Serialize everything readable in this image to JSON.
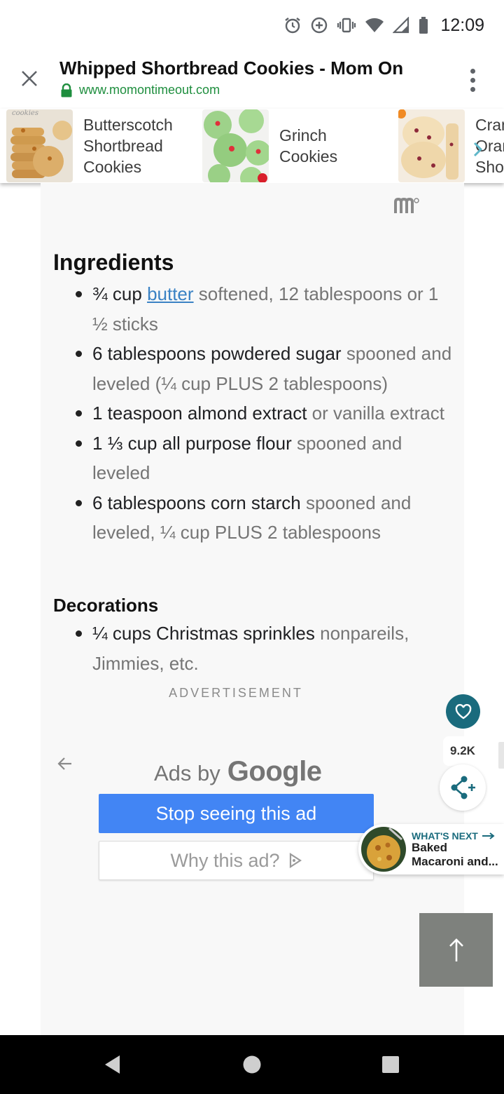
{
  "status_bar": {
    "time": "12:09",
    "icons": [
      "alarm-icon",
      "data-saver-icon",
      "vibrate-icon",
      "wifi-icon",
      "signal-icon",
      "battery-icon"
    ]
  },
  "browser": {
    "title": "Whipped Shortbread Cookies - Mom On",
    "url": "www.momontimeout.com",
    "icons": [
      "close-icon",
      "lock-icon",
      "more-vert-icon"
    ]
  },
  "related": [
    {
      "label": "Butterscotch Shortbread Cookies",
      "lines": [
        "Butterscotch",
        "Shortbread",
        "Cookies"
      ]
    },
    {
      "label": "Grinch Cookies",
      "lines": [
        "Grinch",
        "Cookies"
      ]
    },
    {
      "label": "Cranberry Orange Shortbread",
      "lines": [
        "Cran",
        "Oran",
        "Sho"
      ]
    }
  ],
  "recipe": {
    "ingredients_heading": "Ingredients",
    "ingredients": [
      {
        "pre": "¾ cup ",
        "link": "butter",
        "main": "",
        "note": " softened, 12 tablespoons or 1 ½ sticks"
      },
      {
        "pre": "",
        "link": "",
        "main": "6 tablespoons powdered sugar",
        "note": " spooned and leveled (¼ cup PLUS 2 tablespoons)"
      },
      {
        "pre": "",
        "link": "",
        "main": "1 teaspoon almond extract",
        "note": " or vanilla extract"
      },
      {
        "pre": "",
        "link": "",
        "main": "1 ⅓ cup all purpose flour",
        "note": " spooned and leveled"
      },
      {
        "pre": "",
        "link": "",
        "main": "6 tablespoons corn starch",
        "note": " spooned and leveled, ¼ cup PLUS 2 tablespoons"
      }
    ],
    "decorations_heading": "Decorations",
    "decorations": [
      {
        "main": "¼ cups Christmas sprinkles",
        "note": " nonpareils, Jimmies, etc."
      }
    ]
  },
  "ad": {
    "label": "ADVERTISEMENT",
    "ads_by": "Ads by",
    "google": "Google",
    "stop_label": "Stop seeing this ad",
    "why_label": "Why this ad?"
  },
  "social": {
    "share_count": "9.2K"
  },
  "whats_next": {
    "label": "WHAT'S NEXT",
    "title_line1": "Baked",
    "title_line2": "Macaroni and..."
  },
  "colors": {
    "url_green": "#1e8e3e",
    "link_blue": "#3a82c4",
    "ad_button_blue": "#4285f4",
    "accent_teal": "#1a6b7d",
    "note_gray": "#757575"
  }
}
